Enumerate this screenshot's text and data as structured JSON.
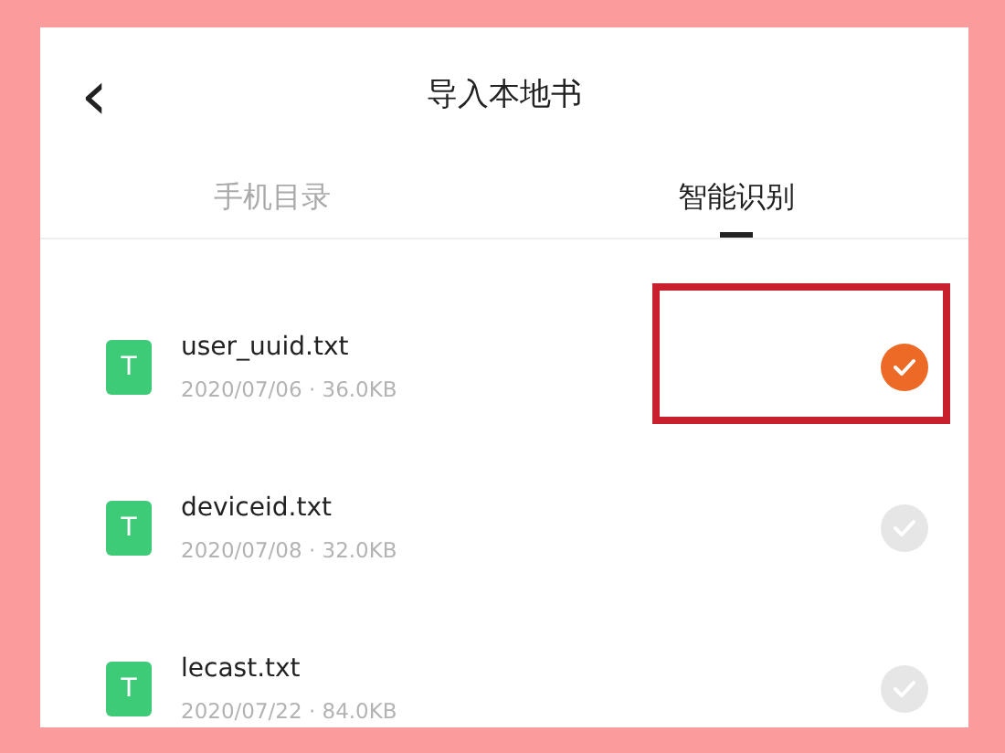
{
  "header": {
    "back": "‹",
    "title": "导入本地书"
  },
  "tabs": [
    {
      "label": "手机目录",
      "selected": false
    },
    {
      "label": "智能识别",
      "selected": true
    }
  ],
  "files": [
    {
      "icon_letter": "T",
      "name": "user_uuid.txt",
      "meta": "2020/07/06 · 36.0KB",
      "selected": true,
      "highlighted": true
    },
    {
      "icon_letter": "T",
      "name": "deviceid.txt",
      "meta": "2020/07/08 · 32.0KB",
      "selected": false,
      "highlighted": false
    },
    {
      "icon_letter": "T",
      "name": "lecast.txt",
      "meta": "2020/07/22 · 84.0KB",
      "selected": false,
      "highlighted": false
    }
  ]
}
